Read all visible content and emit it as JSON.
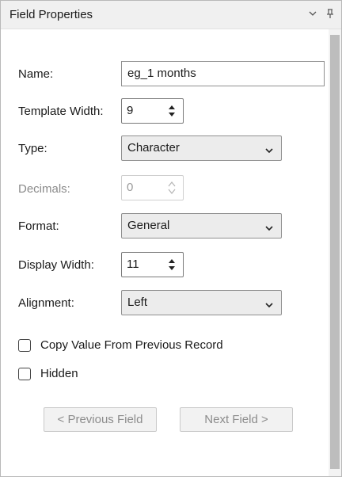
{
  "panel": {
    "title": "Field Properties",
    "icons": {
      "dropdown": "chevron-down-icon",
      "pin": "pin-icon"
    }
  },
  "form": {
    "name": {
      "label": "Name:",
      "value": "eg_1 months"
    },
    "template_width": {
      "label": "Template Width:",
      "value": "9"
    },
    "type": {
      "label": "Type:",
      "value": "Character"
    },
    "decimals": {
      "label": "Decimals:",
      "value": "0",
      "disabled": true
    },
    "format": {
      "label": "Format:",
      "value": "General"
    },
    "display_width": {
      "label": "Display Width:",
      "value": "11"
    },
    "alignment": {
      "label": "Alignment:",
      "value": "Left"
    },
    "copy_value": {
      "label": "Copy Value From Previous Record",
      "checked": false
    },
    "hidden": {
      "label": "Hidden",
      "checked": false
    }
  },
  "buttons": {
    "previous": "< Previous Field",
    "next": "Next Field >"
  }
}
